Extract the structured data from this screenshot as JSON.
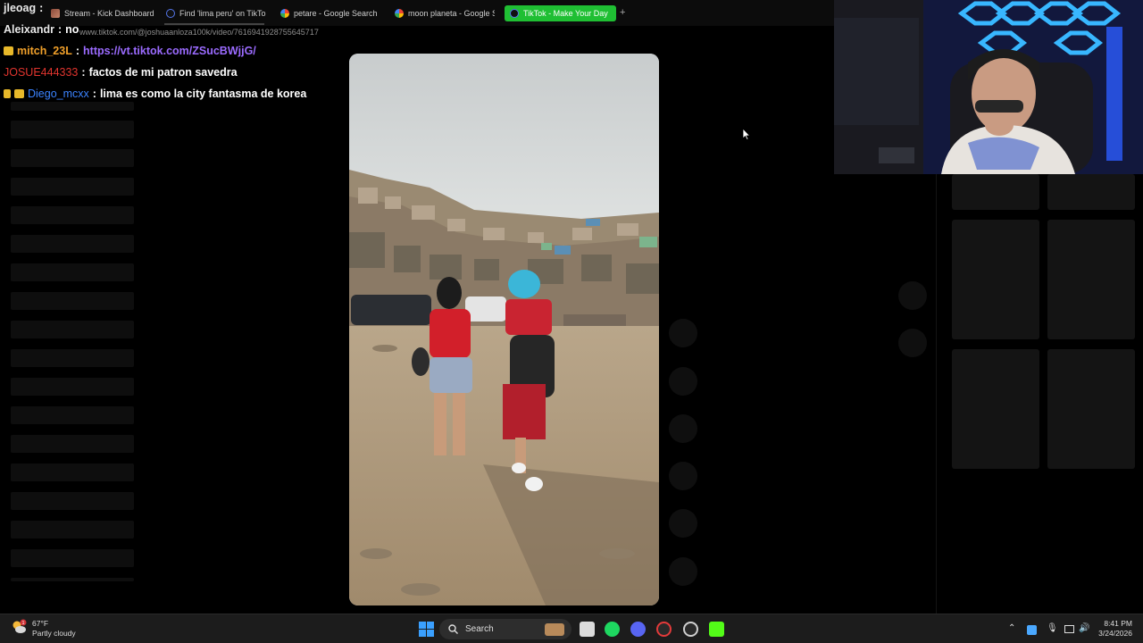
{
  "browser": {
    "tabs": [
      {
        "label": "Stream - Kick Dashboard",
        "favicon": "kick-thumbnail-icon"
      },
      {
        "label": "Find 'lima peru' on TikTok",
        "favicon": "tiktok-icon"
      },
      {
        "label": "petare - Google Search",
        "favicon": "google-icon"
      },
      {
        "label": "moon planeta - Google Se",
        "favicon": "google-icon"
      },
      {
        "label": "TikTok - Make Your Day",
        "favicon": "tiktok-icon",
        "active": true
      }
    ],
    "new_tab": "+",
    "url": "www.tiktok.com/@joshuaanloza100k/video/7616941928755645717",
    "active_tab_color": "#1fbf33"
  },
  "chat": {
    "lines": [
      {
        "user": "jleoag",
        "sep": ":",
        "text": "",
        "user_color": "#e8e8e8"
      },
      {
        "user": "Aleixandr",
        "sep": ":",
        "text": "no",
        "user_color": "#e8e8e8"
      },
      {
        "user": "mitch_23L",
        "sep": ":",
        "text": "https://vt.tiktok.com/ZSucBWjjG/",
        "user_color": "#f0a02a",
        "text_color": "#9b6bff"
      },
      {
        "user": "JOSUE444333",
        "sep": ":",
        "text": "factos de mi patron savedra",
        "user_color": "#e0342e"
      },
      {
        "user": "Diego_mcxx",
        "sep": ":",
        "text": "lima es como la city fantasma de korea",
        "user_color": "#3b83ff"
      }
    ]
  },
  "taskbar": {
    "weather_temp": "67°F",
    "weather_desc": "Partly cloudy",
    "weather_badge": "1",
    "search_placeholder": "Search",
    "time": "8:41 PM",
    "date": "3/24/2026"
  }
}
